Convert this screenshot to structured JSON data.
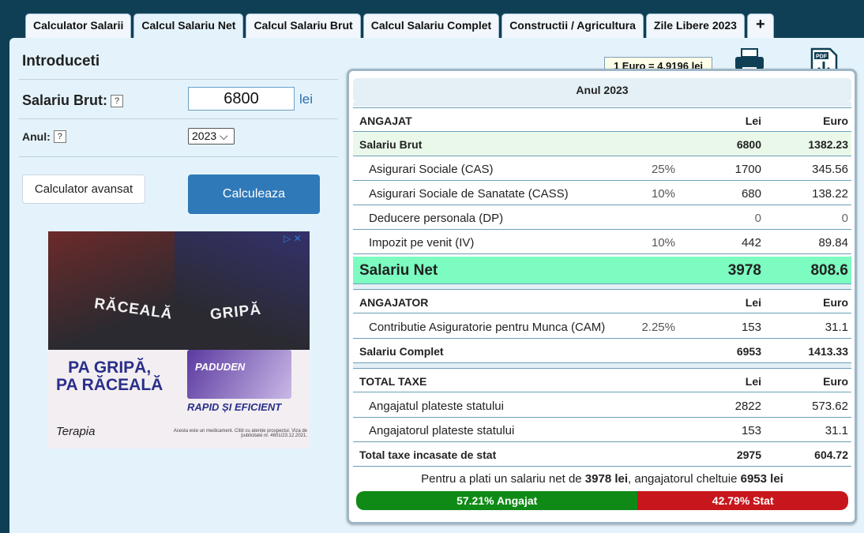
{
  "tabs": [
    {
      "label": "Calculator Salarii",
      "active": false
    },
    {
      "label": "Calcul Salariu Net",
      "active": true
    },
    {
      "label": "Calcul Salariu Brut",
      "active": false
    },
    {
      "label": "Calcul Salariu Complet",
      "active": false
    },
    {
      "label": "Constructii / Agricultura",
      "active": false
    },
    {
      "label": "Zile Libere 2023",
      "active": false
    },
    {
      "label": "+",
      "active": false
    }
  ],
  "form": {
    "title": "Introduceti",
    "brut_label": "Salariu Brut:",
    "brut_value": "6800",
    "brut_unit": "lei",
    "year_label": "Anul:",
    "year_value": "2023 ⌵",
    "help": "?",
    "advanced_button": "Calculator avansat",
    "calc_button": "Calculeaza"
  },
  "ad": {
    "word_left": "RĂCEALĂ",
    "word_right": "GRIPĂ",
    "slogan": "PA GRIPĂ,\nPA RĂCEALĂ",
    "product": "PADUDEN",
    "tagline": "RAPID ȘI EFICIENT",
    "brand": "Terapia",
    "legal": "Acesta este un medicament. Citiți cu atenție prospectul. Viza de publicitate nr. 4601/23.12.2021.",
    "close": "▷ ✕"
  },
  "rate": "1 Euro = 4.9196 lei",
  "icons": {
    "print": "printer-icon",
    "pdf": "pdf-download-icon"
  },
  "results": {
    "year_header": "Anul 2023",
    "angajat": {
      "title": "ANGAJAT",
      "col_lei": "Lei",
      "col_euro": "Euro",
      "brut": {
        "label": "Salariu Brut",
        "lei": "6800",
        "euro": "1382.23"
      },
      "items": [
        {
          "label": "Asigurari Sociale (CAS)",
          "pct": "25%",
          "lei": "1700",
          "euro": "345.56"
        },
        {
          "label": "Asigurari Sociale de Sanatate (CASS)",
          "pct": "10%",
          "lei": "680",
          "euro": "138.22"
        },
        {
          "label": "Deducere personala (DP)",
          "pct": "",
          "lei": "0",
          "euro": "0"
        },
        {
          "label": "Impozit pe venit (IV)",
          "pct": "10%",
          "lei": "442",
          "euro": "89.84"
        }
      ],
      "net": {
        "label": "Salariu Net",
        "lei": "3978",
        "euro": "808.6"
      }
    },
    "angajator": {
      "title": "ANGAJATOR",
      "col_lei": "Lei",
      "col_euro": "Euro",
      "cam": {
        "label": "Contributie Asiguratorie pentru Munca (CAM)",
        "pct": "2.25%",
        "lei": "153",
        "euro": "31.1"
      },
      "complet": {
        "label": "Salariu Complet",
        "lei": "6953",
        "euro": "1413.33"
      }
    },
    "taxe": {
      "title": "TOTAL TAXE",
      "col_lei": "Lei",
      "col_euro": "Euro",
      "items": [
        {
          "label": "Angajatul plateste statului",
          "lei": "2822",
          "euro": "573.62"
        },
        {
          "label": "Angajatorul plateste statului",
          "lei": "153",
          "euro": "31.1"
        }
      ],
      "total": {
        "label": "Total taxe incasate de stat",
        "lei": "2975",
        "euro": "604.72"
      }
    },
    "summary": {
      "pre": "Pentru a plati un salariu net de ",
      "net": "3978 lei",
      "mid": ", angajatorul cheltuie ",
      "cost": "6953 lei"
    },
    "split": {
      "employee_fraction": 0.5721,
      "employee_label": "57.21% Angajat",
      "state_label": "42.79% Stat",
      "employee_color": "#0f8a16",
      "state_color": "#c8171c"
    }
  }
}
